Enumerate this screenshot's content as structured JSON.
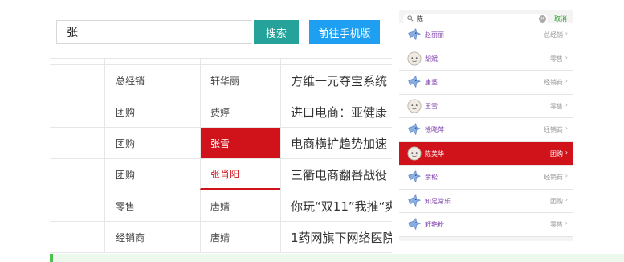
{
  "search": {
    "value": "张",
    "button_label": "搜索",
    "mobile_button_label": "前往手机版"
  },
  "table": {
    "rows": [
      {
        "role": "总经销",
        "name": "轩华丽",
        "title": "方维一元夺宝系统",
        "state": "normal"
      },
      {
        "role": "团购",
        "name": "费婷",
        "title": "进口电商：亚健康",
        "state": "normal"
      },
      {
        "role": "团购",
        "name": "张雪",
        "title": "电商横扩趋势加速",
        "state": "selected"
      },
      {
        "role": "团购",
        "name": "张肖阳",
        "title": "三衢电商翻番战役",
        "state": "highlight"
      },
      {
        "role": "零售",
        "name": "唐婧",
        "title": "你玩“双11”我推“爽",
        "state": "normal"
      },
      {
        "role": "经销商",
        "name": "唐婧",
        "title": "1药网旗下网络医院",
        "state": "normal"
      }
    ]
  },
  "mobile": {
    "search_icon": "search-icon",
    "search_value": "陈",
    "clear_icon": "clear-icon",
    "cancel_label": "取消",
    "items": [
      {
        "name": "赵丽丽",
        "role": "总经销",
        "avatar": "bird-avatar",
        "selected": false
      },
      {
        "name": "胡斌",
        "role": "零售",
        "avatar": "face-avatar",
        "selected": false
      },
      {
        "name": "唐坚",
        "role": "经销商",
        "avatar": "bird-avatar",
        "selected": false
      },
      {
        "name": "王雪",
        "role": "零售",
        "avatar": "face-avatar",
        "selected": false
      },
      {
        "name": "徐晓萍",
        "role": "经销商",
        "avatar": "bird-avatar",
        "selected": false
      },
      {
        "name": "陈美华",
        "role": "团购",
        "avatar": "face-avatar",
        "selected": true
      },
      {
        "name": "余松",
        "role": "经销商",
        "avatar": "bird-avatar",
        "selected": false
      },
      {
        "name": "知足常乐",
        "role": "团购",
        "avatar": "bird-avatar",
        "selected": false
      },
      {
        "name": "轩艳粉",
        "role": "零售",
        "avatar": "bird-avatar",
        "selected": false
      }
    ],
    "chevron": "›"
  },
  "colors": {
    "teal": "#25a39a",
    "blue": "#1e9ff2",
    "red": "#d0121b",
    "purple": "#7a3aa8",
    "notice_green": "#4cc04c"
  }
}
